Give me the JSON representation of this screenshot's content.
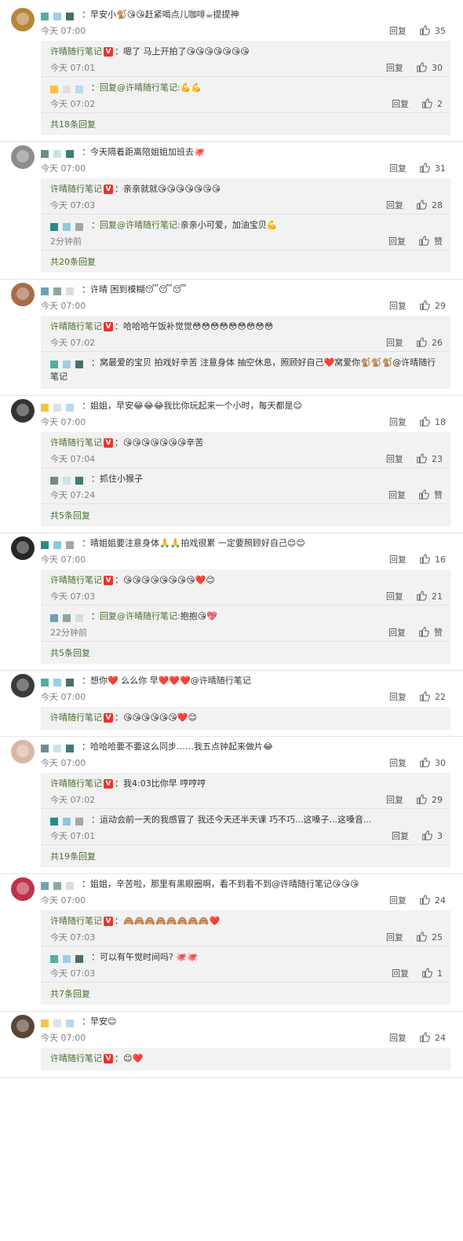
{
  "colors": {
    "link": "#4a6e2e",
    "badge": "#e8352e",
    "reply_bg": "#f2f2f2"
  },
  "labels": {
    "reply": "回复",
    "like_zero": "赞"
  },
  "author": "许晴随行笔记",
  "comments": [
    {
      "text": "早安小🐒😘😘赶紧喝点儿咖啡☕提提神",
      "time": "今天 07:00",
      "likes": "35",
      "replies": [
        {
          "prefix": "",
          "text": "嗯了 马上开拍了😘😘😘😘😘😘😘",
          "time": "今天 07:01",
          "likes": "30"
        },
        {
          "prefix": "回复@许晴随行笔记:",
          "text": "💪💪",
          "time": "今天 07:02",
          "likes": "2"
        }
      ],
      "more": "共18条回复"
    },
    {
      "text": "今天隔着距离陪姐姐加班去🐙",
      "time": "今天 07:00",
      "likes": "31",
      "replies": [
        {
          "prefix": "",
          "text": "亲亲就就😘😘😘😘😘😘😘",
          "time": "今天 07:03",
          "likes": "28"
        },
        {
          "prefix": "回复@许晴随行笔记:",
          "text": "亲亲小可爱，加油宝贝💪",
          "time": "2分钟前",
          "likes": "赞"
        }
      ],
      "more": "共20条回复"
    },
    {
      "text": "许晴 困到模糊😴😴😴",
      "time": "今天 07:00",
      "likes": "29",
      "replies": [
        {
          "prefix": "",
          "text": "哈哈哈午饭补觉觉😳😳😳😳😳😳😳😳😳",
          "time": "今天 07:02",
          "likes": "26"
        },
        {
          "prefix": "",
          "text": "窝最爱的宝贝 拍戏好辛苦 注意身体 抽空休息，照顾好自己❤️窝爱你🐒🐒🐒@许晴随行笔记",
          "time": "",
          "likes": ""
        }
      ],
      "more": ""
    },
    {
      "text": "姐姐，早安😂😂😂我比你玩起来一个小时，每天都是😊",
      "time": "今天 07:00",
      "likes": "18",
      "replies": [
        {
          "prefix": "",
          "text": "😘😘😘😘😘😘😘辛苦",
          "time": "今天 07:04",
          "likes": "23"
        },
        {
          "prefix": "",
          "text": "抓住小猴子",
          "time": "今天 07:24",
          "likes": "赞"
        }
      ],
      "more": "共5条回复"
    },
    {
      "text": "晴姐姐要注意身体🙏🙏拍戏很累 一定要照顾好自己😊😊",
      "time": "今天 07:00",
      "likes": "16",
      "replies": [
        {
          "prefix": "",
          "text": "😘😘😘😘😘😘😘😘❤️😊",
          "time": "今天 07:03",
          "likes": "21"
        },
        {
          "prefix": "回复@许晴随行笔记:",
          "text": "抱抱😘💖",
          "time": "22分钟前",
          "likes": "赞"
        }
      ],
      "more": "共5条回复"
    },
    {
      "text": "想你❤️ 么么你 早❤️❤️❤️@许晴随行笔记",
      "time": "今天 07:00",
      "likes": "22",
      "replies": [
        {
          "prefix": "",
          "text": "😘😘😘😘😘😘❤️😊",
          "time": "",
          "likes": ""
        }
      ],
      "more": ""
    },
    {
      "text": "哈哈哈要不要这么同步……我五点钟起来做片😂",
      "time": "今天 07:00",
      "likes": "30",
      "replies": [
        {
          "prefix": "",
          "text": "我4:03比你早 哼哼哼",
          "time": "今天 07:02",
          "likes": "29"
        },
        {
          "prefix": "",
          "text": "运动会前一天的我感冒了 我还今天还半天课 巧不巧...这嗓子...这嗓音...",
          "time": "今天 07:01",
          "likes": "3"
        }
      ],
      "more": "共19条回复"
    },
    {
      "text": "姐姐，辛苦啦，那里有黑眼圈啊，看不到看不到@许晴随行笔记😘😘😘",
      "time": "今天 07:00",
      "likes": "24",
      "replies": [
        {
          "prefix": "",
          "text": "🙈🙈🙈🙈🙈🙈🙈🙈❤️",
          "time": "今天 07:03",
          "likes": "25"
        },
        {
          "prefix": "",
          "text": "可以有午觉时间吗? 🐙🐙",
          "time": "今天 07:03",
          "likes": "1"
        }
      ],
      "more": "共7条回复"
    },
    {
      "text": "早安😊",
      "time": "今天 07:00",
      "likes": "24",
      "replies": [
        {
          "prefix": "",
          "text": "😊❤️",
          "time": "",
          "likes": ""
        }
      ],
      "more": ""
    }
  ]
}
